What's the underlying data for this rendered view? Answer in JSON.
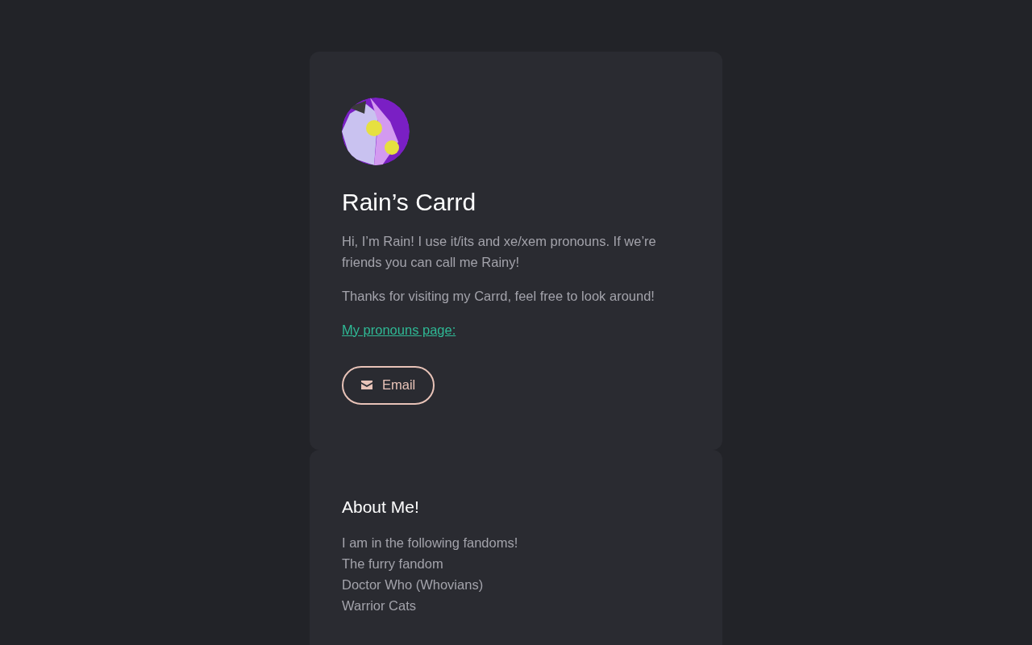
{
  "profile": {
    "title": "Rain’s Carrd",
    "paragraphs": [
      "Hi, I’m Rain! I use it/its and xe/xem pronouns. If we’re friends you can call me Rainy!",
      "Thanks for visiting my Carrd, feel free to look around!"
    ],
    "link": "My pronouns page:",
    "button": "Email"
  },
  "about": {
    "title": "About Me!",
    "lines": [
      "I am in the following fandoms!",
      "The furry fandom",
      "Doctor Who (Whovians)",
      "Warrior Cats"
    ]
  }
}
